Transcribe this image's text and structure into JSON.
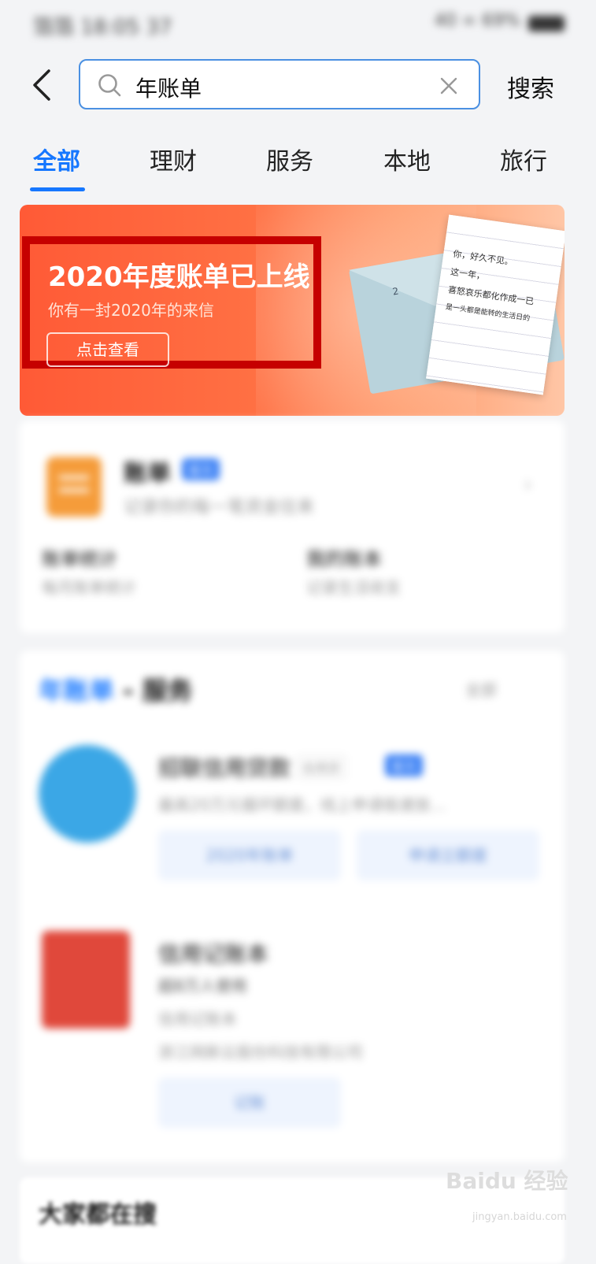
{
  "status_bar": {
    "left": "箔箔 18:05 37",
    "right": "40 ∞ 69%"
  },
  "search": {
    "query": "年账单",
    "button_label": "搜索"
  },
  "tabs": [
    {
      "label": "全部",
      "active": true
    },
    {
      "label": "理财",
      "active": false
    },
    {
      "label": "服务",
      "active": false
    },
    {
      "label": "本地",
      "active": false
    },
    {
      "label": "旅行",
      "active": false
    }
  ],
  "banner": {
    "title": "2020年度账单已上线",
    "subtitle": "你有一封2020年的来信",
    "button_label": "点击查看",
    "letter_lines": [
      "你，好久不见。",
      "这一年，",
      "喜怒哀乐都化作成一已",
      "是一头都是能转的生活日的"
    ],
    "envelope_number": "2"
  },
  "bill_card": {
    "title": "账单",
    "badge": "官方",
    "desc": "记录你的每一笔资金往来",
    "links": [
      {
        "title": "账单统计",
        "desc": "每月账单统计"
      },
      {
        "title": "我的账本",
        "desc": "记录生活收支"
      }
    ]
  },
  "service_section": {
    "title_highlight": "年账单",
    "title_rest": " - 服务",
    "more": "全部",
    "items": [
      {
        "title": "招联信用贷款",
        "tag": "信用贷",
        "badge": "官方",
        "desc": "最高20万元循环额度，线上申请极速放…",
        "buttons": [
          "2020年账单",
          "申请立额度"
        ]
      },
      {
        "title": "信用记账本",
        "meta": "超8万人使用",
        "desc": "信用记账本",
        "company": "浙江网新云股份科技有限公司",
        "buttons": [
          "记账"
        ]
      }
    ]
  },
  "trending": {
    "title": "大家都在搜"
  },
  "watermark": {
    "text": "Baidu 经验",
    "url": "jingyan.baidu.com"
  },
  "colors": {
    "accent": "#1677ff",
    "banner": "#ff5a36",
    "highlight_box": "#c60000"
  }
}
